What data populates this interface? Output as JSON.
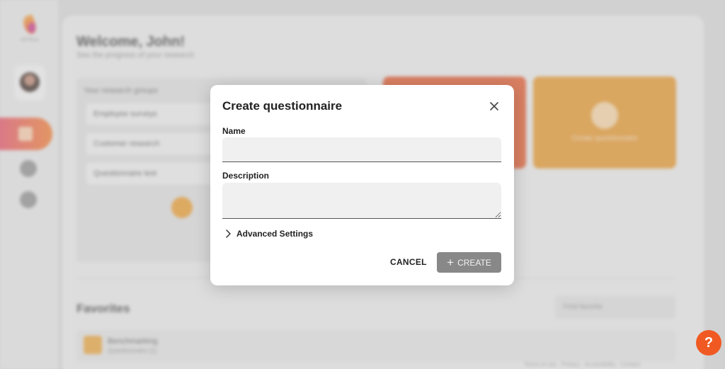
{
  "background": {
    "logo_text": "DITTO.AI",
    "welcome_title": "Welcome, John!",
    "welcome_subtitle": "See the progress of your research",
    "list_header": "Your research groups",
    "list_items": [
      "Employee surveys",
      "Customer research",
      "Questionnaire test"
    ],
    "tile_red_label": "",
    "tile_gold_label": "Create questionnaire",
    "favorites_title": "Favorites",
    "favorites_search_placeholder": "Find favorite",
    "favorite_item_title": "Benchmarking",
    "favorite_item_subtitle": "Questionnaire (1)",
    "footer": "Terms of use · Privacy · Accessibility · Contact"
  },
  "dialog": {
    "title": "Create questionnaire",
    "name_label": "Name",
    "name_value": "",
    "description_label": "Description",
    "description_value": "",
    "advanced_label": "Advanced Settings",
    "cancel_label": "CANCEL",
    "create_label": "CREATE",
    "create_enabled": false
  },
  "help_label": "?",
  "colors": {
    "accent_orange": "#f05a22",
    "create_disabled": "#888888",
    "tile_red": "#e2582c",
    "tile_gold": "#e4952a"
  },
  "icons": {
    "close": "close-icon",
    "advanced": "chevron-right-icon",
    "create": "plus-icon",
    "help": "question-icon"
  }
}
